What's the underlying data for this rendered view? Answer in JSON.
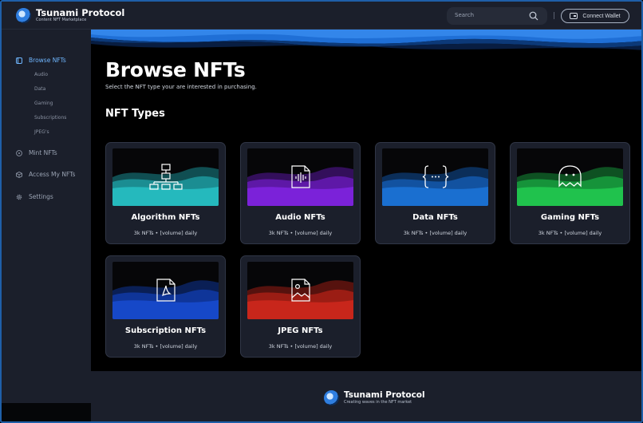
{
  "brand": {
    "name": "Tsunami Protocol",
    "tagline": "Content NFT Marketplace"
  },
  "header": {
    "search_placeholder": "Search",
    "connect_label": "Connect Wallet"
  },
  "sidebar": {
    "browse": "Browse NFTs",
    "sub": [
      "Audio",
      "Data",
      "Gaming",
      "Subscriptions",
      "JPEG's"
    ],
    "mint": "Mint NFTs",
    "access": "Access My NFTs",
    "settings": "Settings"
  },
  "main": {
    "title": "Browse NFTs",
    "subtitle": "Select the NFT type your are interested in purchasing.",
    "section": "NFT Types",
    "cards": [
      {
        "title": "Algorithm NFTs",
        "meta": "3k NFTs • [volume] daily",
        "icon": "hierarchy-icon",
        "color": "#1fa3a8"
      },
      {
        "title": "Audio NFTs",
        "meta": "3k NFTs • [volume] daily",
        "icon": "audio-file-icon",
        "color": "#7b1fd6"
      },
      {
        "title": "Data NFTs",
        "meta": "3k NFTs • [volume] daily",
        "icon": "code-braces-icon",
        "color": "#1a6fd0"
      },
      {
        "title": "Gaming NFTs",
        "meta": "3k NFTs • [volume] daily",
        "icon": "ghost-icon",
        "color": "#1fbf4a"
      },
      {
        "title": "Subscription NFTs",
        "meta": "3k NFTs • [volume] daily",
        "icon": "pdf-file-icon",
        "color": "#1446c8"
      },
      {
        "title": "JPEG NFTs",
        "meta": "3k NFTs • [volume] daily",
        "icon": "image-file-icon",
        "color": "#c8261b"
      }
    ]
  },
  "footer": {
    "name": "Tsunami Protocol",
    "tagline": "Creating waves in the NFT market"
  },
  "colors": {
    "accent": "#6fb6ff",
    "panel": "#1b1f2b",
    "wave": "#1f6fd6"
  }
}
